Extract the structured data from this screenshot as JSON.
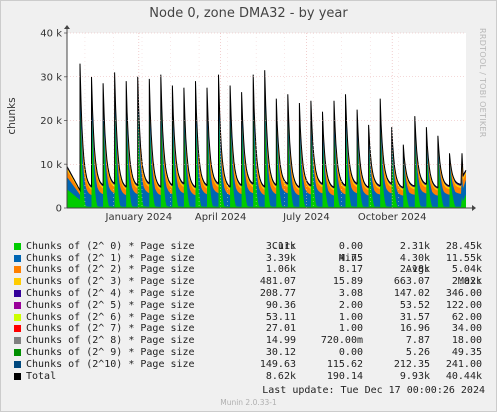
{
  "window": {
    "title": "Node 0, zone DMA32 - by year",
    "watermark": "RRDTOOL / TOBI OETIKER",
    "footer": "Munin 2.0.33-1"
  },
  "chart_data": {
    "type": "area",
    "stacked": true,
    "title": "Node 0, zone DMA32 - by year",
    "ylabel": "chunks",
    "ylim": [
      0,
      40000
    ],
    "yticks": [
      {
        "value": 0,
        "label": "0"
      },
      {
        "value": 10000,
        "label": "10 k"
      },
      {
        "value": 20000,
        "label": "20 k"
      },
      {
        "value": 30000,
        "label": "30 k"
      },
      {
        "value": 40000,
        "label": "40 k"
      }
    ],
    "xticks": [
      {
        "label": "January 2024",
        "position": 0.18
      },
      {
        "label": "April 2024",
        "position": 0.385
      },
      {
        "label": "July 2024",
        "position": 0.6
      },
      {
        "label": "October 2024",
        "position": 0.815
      }
    ],
    "grid": true,
    "cycle_peaks_total": [
      33000,
      30000,
      28500,
      31000,
      29000,
      30000,
      29500,
      30500,
      28000,
      27500,
      29000,
      27500,
      30500,
      28000,
      26500,
      30500,
      31500,
      25000,
      26000,
      24000,
      24500,
      22000,
      24500,
      26000,
      22500,
      19000,
      25000,
      18500,
      14500,
      21000,
      18500,
      16500,
      12500
    ],
    "series": [
      {
        "name": "Chunks of (2^ 0) * Page size",
        "color": "#00cc00",
        "cur": "3.11k",
        "min": "0.00",
        "avg": "2.31k",
        "max": "28.45k"
      },
      {
        "name": "Chunks of (2^ 1) * Page size",
        "color": "#0066b3",
        "cur": "3.39k",
        "min": "4.75",
        "avg": "4.30k",
        "max": "11.55k"
      },
      {
        "name": "Chunks of (2^ 2) * Page size",
        "color": "#ff8000",
        "cur": "1.06k",
        "min": "8.17",
        "avg": "2.18k",
        "max": "5.04k"
      },
      {
        "name": "Chunks of (2^ 3) * Page size",
        "color": "#ffcc00",
        "cur": "481.07",
        "min": "15.89",
        "avg": "663.07",
        "max": "2.02k"
      },
      {
        "name": "Chunks of (2^ 4) * Page size",
        "color": "#330099",
        "cur": "208.77",
        "min": "3.08",
        "avg": "147.02",
        "max": "346.00"
      },
      {
        "name": "Chunks of (2^ 5) * Page size",
        "color": "#990099",
        "cur": "90.36",
        "min": "2.00",
        "avg": "53.52",
        "max": "122.00"
      },
      {
        "name": "Chunks of (2^ 6) * Page size",
        "color": "#ccff00",
        "cur": "53.11",
        "min": "1.00",
        "avg": "31.57",
        "max": "62.00"
      },
      {
        "name": "Chunks of (2^ 7) * Page size",
        "color": "#ff0000",
        "cur": "27.01",
        "min": "1.00",
        "avg": "16.96",
        "max": "34.00"
      },
      {
        "name": "Chunks of (2^ 8) * Page size",
        "color": "#808080",
        "cur": "14.99",
        "min": "720.00m",
        "avg": "7.87",
        "max": "18.00"
      },
      {
        "name": "Chunks of (2^ 9) * Page size",
        "color": "#008f00",
        "cur": "30.12",
        "min": "0.00",
        "avg": "5.26",
        "max": "49.35"
      },
      {
        "name": "Chunks of (2^10) * Page size",
        "color": "#00487d",
        "cur": "149.63",
        "min": "115.62",
        "avg": "212.35",
        "max": "241.00"
      },
      {
        "name": "Total",
        "color": "#000000",
        "cur": "8.62k",
        "min": "190.14",
        "avg": "9.93k",
        "max": "40.44k"
      }
    ]
  },
  "legend_header": {
    "cur": "Cur:",
    "min": "Min:",
    "avg": "Avg:",
    "max": "Max:"
  },
  "last_update": "Last update: Tue Dec 17 00:00:26 2024"
}
